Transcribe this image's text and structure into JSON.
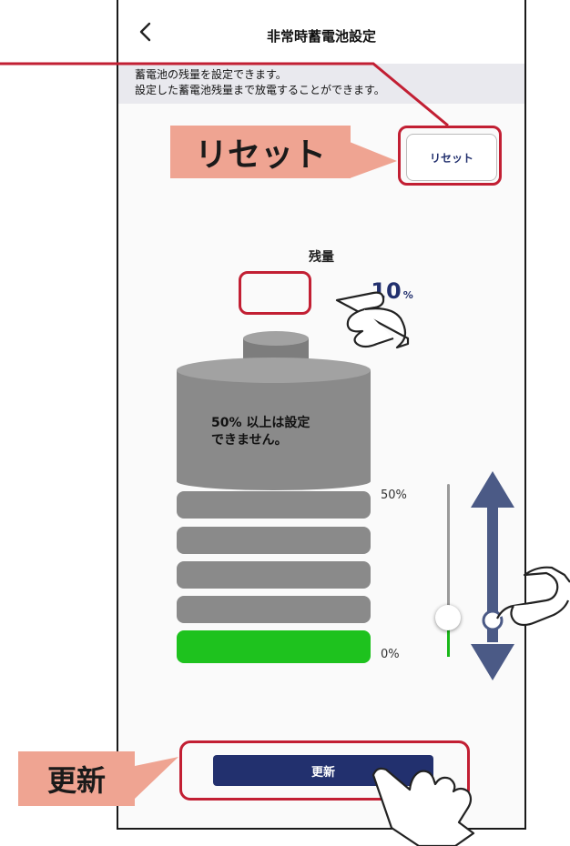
{
  "header": {
    "title": "非常時蓄電池設定",
    "back_icon": "chevron-left-icon"
  },
  "info": {
    "line1": "蓄電池の残量を設定できます。",
    "line2": "設定した蓄電池残量まで放電することができます。"
  },
  "reset_button_label": "リセット",
  "remain": {
    "label": "残量",
    "value": "10",
    "unit": "%"
  },
  "battery": {
    "limit_message_line1": "50% 以上は設定",
    "limit_message_line2": "できません。",
    "label_50": "50%",
    "label_0": "0%",
    "colors": {
      "body": "#8a8a8a",
      "fill": "#1ec21e",
      "top": "#a2a2a2"
    }
  },
  "slider": {
    "value_percent": 10,
    "max_percent": 50
  },
  "update_button_label": "更新",
  "annotations": {
    "reset_callout": "リセット",
    "update_callout": "更新",
    "highlight_color": "#c21f33",
    "callout_color": "#efa492",
    "arrow_color": "#4b5a86"
  }
}
